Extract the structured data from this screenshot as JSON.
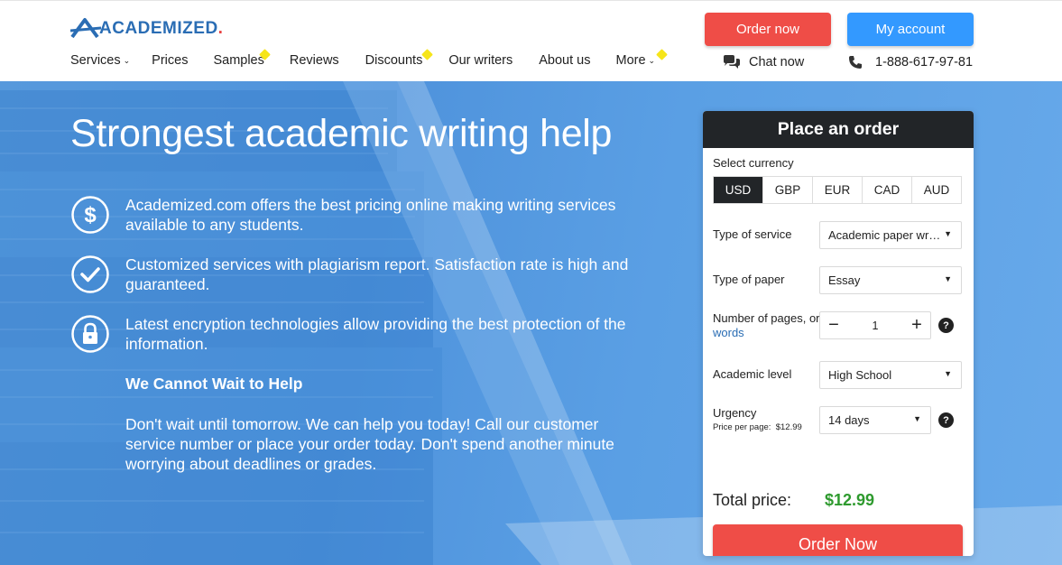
{
  "brand": {
    "name": "ACADEMIZED",
    "dot": "."
  },
  "nav": {
    "services": "Services",
    "prices": "Prices",
    "samples": "Samples",
    "reviews": "Reviews",
    "discounts": "Discounts",
    "writers": "Our writers",
    "about": "About us",
    "more": "More"
  },
  "header": {
    "order_label": "Order now",
    "account_label": "My account",
    "chat_label": "Chat now",
    "phone": "1-888-617-97-81"
  },
  "hero": {
    "title": "Strongest academic writing help",
    "features": [
      {
        "icon": "dollar-icon",
        "text": "Academized.com offers the best pricing online making writing services available to any students."
      },
      {
        "icon": "checkmark-icon",
        "text": "Customized services with plagiarism report. Satisfaction rate is high and guaranteed."
      },
      {
        "icon": "lock-icon",
        "text": "Latest encryption technologies allow providing the best protection of the information."
      }
    ],
    "sub_title": "We Cannot Wait to Help",
    "sub_text": "Don't wait until tomorrow. We can help you today! Call our customer service number or place your order today. Don't spend another minute worrying about deadlines or grades."
  },
  "order_panel": {
    "title": "Place an order",
    "currency_label": "Select currency",
    "currencies": [
      "USD",
      "GBP",
      "EUR",
      "CAD",
      "AUD"
    ],
    "selected_currency": "USD",
    "service_label": "Type of service",
    "service_value": "Academic paper writing",
    "paper_label": "Type of paper",
    "paper_value": "Essay",
    "pages_label": "Number of pages, or",
    "words_link": "words",
    "pages_value": "1",
    "level_label": "Academic level",
    "level_value": "High School",
    "urgency_label": "Urgency",
    "price_per_page_label": "Price per page:",
    "price_per_page": "$12.99",
    "urgency_value": "14 days",
    "total_label": "Total price:",
    "total_value": "$12.99",
    "order_button": "Order Now",
    "help_mark": "?"
  },
  "colors": {
    "accent_red": "#ef4d47",
    "accent_blue": "#3399ff",
    "hero_blue": "#4f93dc",
    "price_green": "#2e9a2e",
    "panel_dark": "#222528"
  }
}
